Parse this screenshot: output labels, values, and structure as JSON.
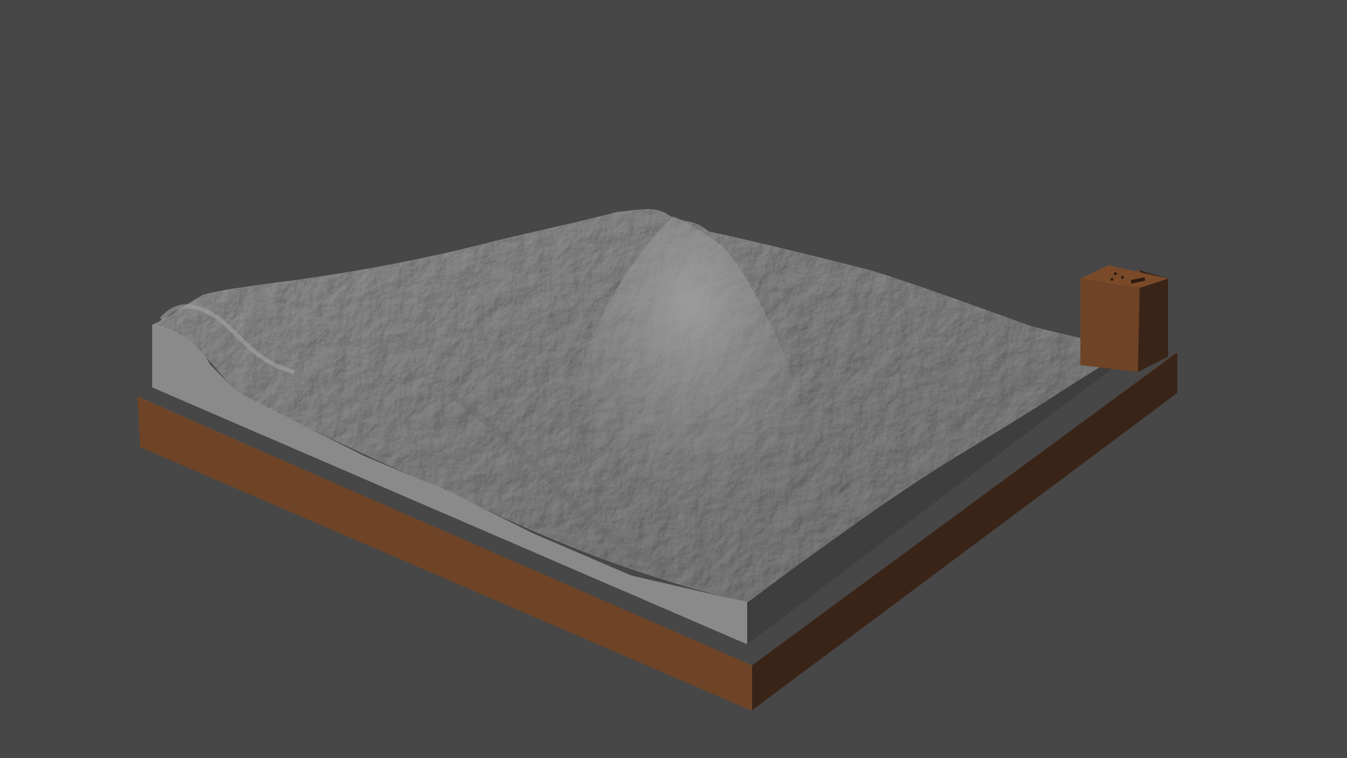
{
  "viewport": {
    "background": "#474747"
  },
  "model": {
    "description_icon": "terrain-model-icon",
    "terrain_top_color": "#8e8e8e",
    "terrain_side_color": "#8a8a8a",
    "terrain_side_dark_color": "#3c3c3c",
    "base_front_color": "#6e4426",
    "base_side_color": "#3a2418",
    "base_top_color": "#7a4a28",
    "stand_color": "#6f4326"
  }
}
